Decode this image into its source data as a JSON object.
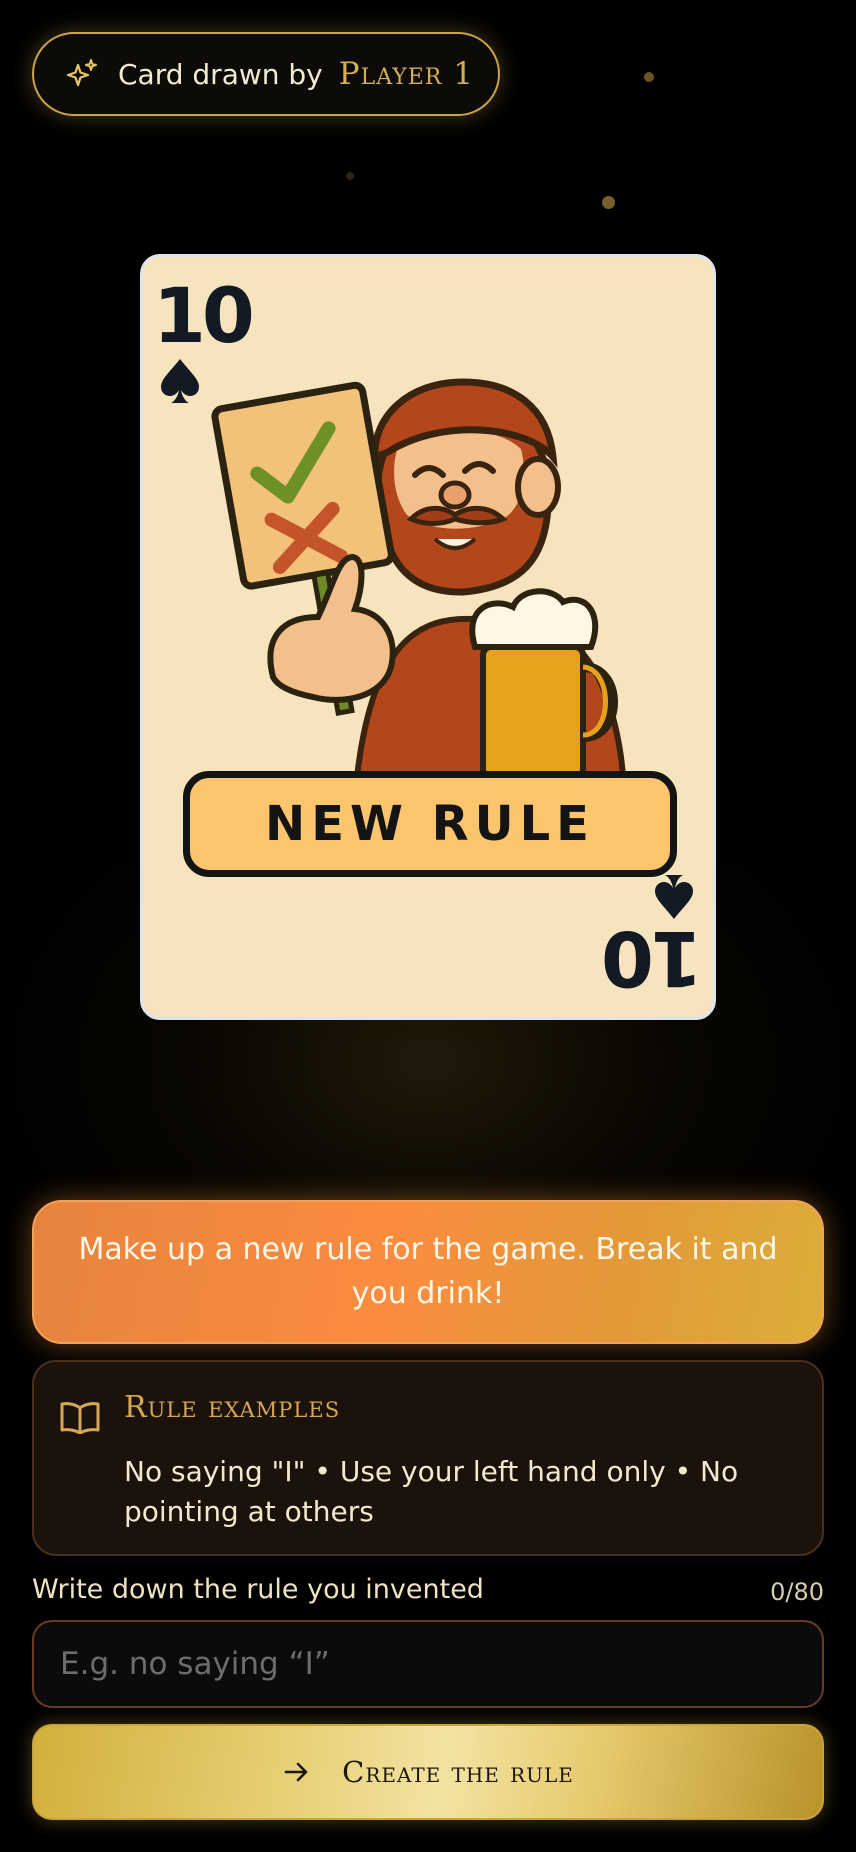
{
  "header": {
    "drawn_label": "Card drawn by",
    "player_name": "Player 1",
    "icon": "sparkle-icon"
  },
  "card": {
    "rank": "10",
    "suit": "spade",
    "title": "NEW RULE",
    "background_color": "#f6e4bf"
  },
  "instruction": {
    "text": "Make up a new rule for the game. Break it and you drink!"
  },
  "examples": {
    "icon": "book-icon",
    "title": "Rule examples",
    "text": "No saying \"I\" • Use your left hand only • No pointing at others"
  },
  "rule_input": {
    "label": "Write down the rule you invented",
    "counter": "0/80",
    "value": "",
    "placeholder": "E.g. no saying “I”"
  },
  "create_button": {
    "label": "Create the rule",
    "icon": "arrow-right-icon"
  },
  "colors": {
    "background": "#000000",
    "gold": "#d5ad57",
    "orange": "#fb8c3f"
  }
}
